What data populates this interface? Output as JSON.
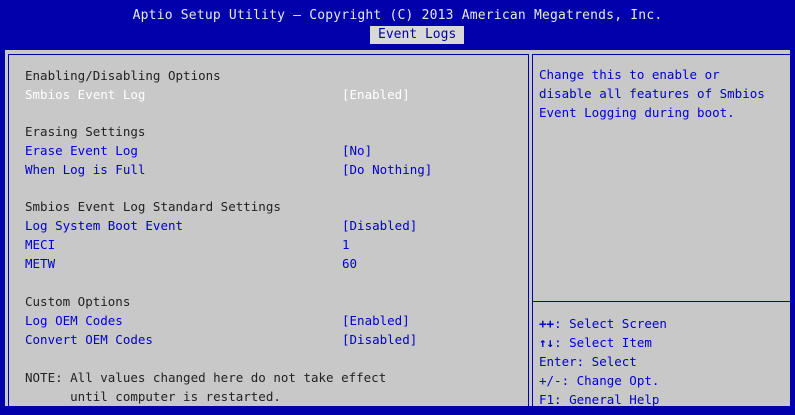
{
  "header": {
    "title": "Aptio Setup Utility – Copyright (C) 2013 American Megatrends, Inc.",
    "active_tab": "Event Logs"
  },
  "sections": {
    "enabling": {
      "heading": "Enabling/Disabling Options",
      "smbios_event_log": {
        "label": "Smbios Event Log",
        "value": "[Enabled]"
      }
    },
    "erasing": {
      "heading": "Erasing Settings",
      "erase_event_log": {
        "label": "Erase Event Log",
        "value": "[No]"
      },
      "when_log_full": {
        "label": "When Log is Full",
        "value": "[Do Nothing]"
      }
    },
    "standard": {
      "heading": "Smbios Event Log Standard Settings",
      "log_system_boot": {
        "label": "Log System Boot Event",
        "value": "[Disabled]"
      },
      "meci": {
        "label": "MECI",
        "value": "1"
      },
      "metw": {
        "label": "METW",
        "value": "60"
      }
    },
    "custom": {
      "heading": "Custom Options",
      "log_oem_codes": {
        "label": "Log OEM Codes",
        "value": "[Enabled]"
      },
      "convert_oem_codes": {
        "label": "Convert OEM Codes",
        "value": "[Disabled]"
      }
    }
  },
  "note": {
    "line1": "NOTE: All values changed here do not take effect",
    "line2": "      until computer is restarted."
  },
  "help": {
    "description": "Change this to enable or\ndisable all features of Smbios\nEvent Logging during boot.",
    "keys": {
      "select_screen_key": "++",
      "select_screen": ": Select Screen",
      "select_item_key": "↑↓",
      "select_item": ": Select Item",
      "enter": "Enter: Select",
      "change": "+/-: Change Opt.",
      "f1": "F1: General Help"
    }
  },
  "colors": {
    "background": "#0000aa",
    "panel": "#c8c8c8",
    "highlight": "#ffffff",
    "item_text": "#0000cc"
  }
}
